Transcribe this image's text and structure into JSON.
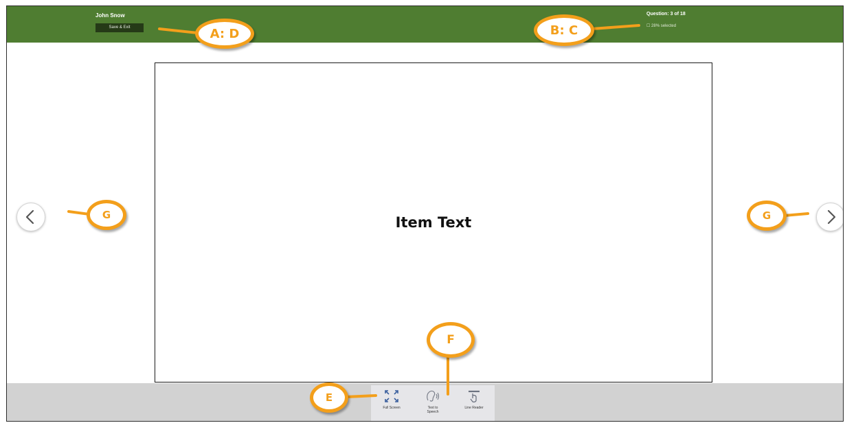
{
  "header": {
    "user_name": "John Snow",
    "save_exit_label": "Save & Exit",
    "question_counter": "Question: 3 of 18",
    "selected_note": "☐ 28% selected"
  },
  "item": {
    "text": "Item Text"
  },
  "navigation": {
    "prev_icon": "chevron-left-icon",
    "next_icon": "chevron-right-icon"
  },
  "toolbar": {
    "tools": [
      {
        "label": "Full Screen",
        "icon": "full-screen-icon"
      },
      {
        "label": "Text to Speech",
        "icon": "text-to-speech-icon"
      },
      {
        "label": "Line Reader",
        "icon": "line-reader-icon"
      }
    ]
  },
  "callouts": {
    "a": "A: D",
    "b": "B: C",
    "e": "E",
    "f": "F",
    "g_left": "G",
    "g_right": "G"
  },
  "colors": {
    "header_green": "#4f7d31",
    "button_dark_green": "#253a17",
    "callout_orange": "#f39f1b",
    "footer_gray": "#d2d2d2",
    "icon_blue": "#3a5f9e"
  }
}
